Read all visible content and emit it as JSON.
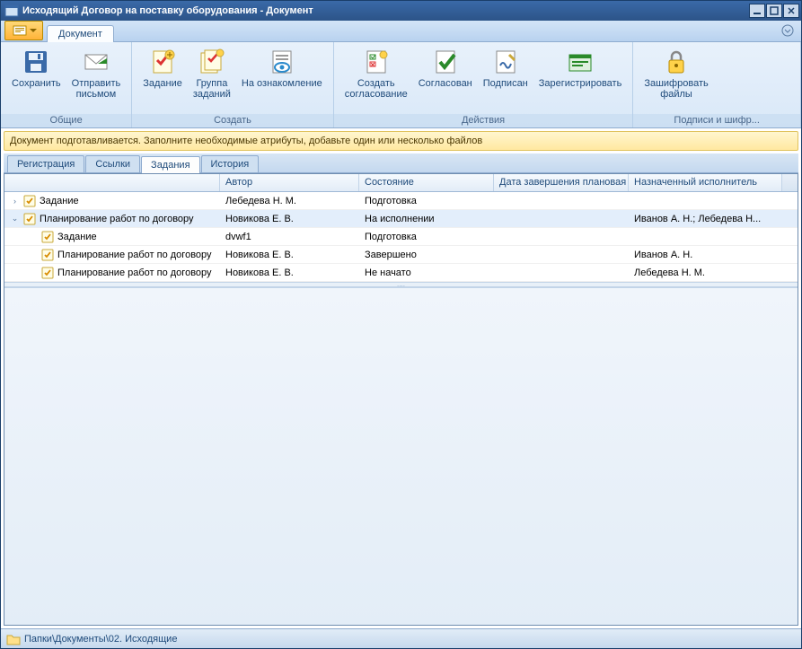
{
  "window": {
    "title": "Исходящий Договор на поставку оборудования - Документ"
  },
  "ribbon": {
    "tab": "Документ",
    "groups": {
      "general": {
        "label": "Общие",
        "save": "Сохранить",
        "send": "Отправить\nписьмом"
      },
      "create": {
        "label": "Создать",
        "task": "Задание",
        "taskgroup": "Группа\nзаданий",
        "review": "На ознакомление"
      },
      "actions": {
        "label": "Действия",
        "approval": "Создать\nсогласование",
        "approved": "Согласован",
        "signed": "Подписан",
        "register": "Зарегистрировать"
      },
      "sign": {
        "label": "Подписи и шифр...",
        "encrypt": "Зашифровать\nфайлы"
      }
    }
  },
  "infobar": "Документ подготавливается. Заполните необходимые атрибуты, добавьте один или несколько файлов",
  "tabs": {
    "reg": "Регистрация",
    "links": "Ссылки",
    "tasks": "Задания",
    "history": "История"
  },
  "grid": {
    "headers": {
      "author": "Автор",
      "state": "Состояние",
      "due": "Дата завершения плановая",
      "assignee": "Назначенный исполнитель"
    },
    "rows": [
      {
        "indent": 0,
        "expander": "›",
        "name": "Задание",
        "author": "Лебедева Н. М.",
        "state": "Подготовка",
        "due": "",
        "assignee": "",
        "selected": false
      },
      {
        "indent": 0,
        "expander": "⌄",
        "name": "Планирование работ по договору",
        "author": "Новикова Е. В.",
        "state": "На исполнении",
        "due": "",
        "assignee": "Иванов А. Н.; Лебедева Н...",
        "selected": true
      },
      {
        "indent": 1,
        "expander": "",
        "name": "Задание",
        "author": "dvwf1",
        "state": "Подготовка",
        "due": "",
        "assignee": "",
        "selected": false
      },
      {
        "indent": 1,
        "expander": "",
        "name": "Планирование работ по договору",
        "author": "Новикова Е. В.",
        "state": "Завершено",
        "due": "",
        "assignee": "Иванов А. Н.",
        "selected": false
      },
      {
        "indent": 1,
        "expander": "",
        "name": "Планирование работ по договору",
        "author": "Новикова Е. В.",
        "state": "Не начато",
        "due": "",
        "assignee": "Лебедева Н. М.",
        "selected": false
      }
    ]
  },
  "statusbar": {
    "path": "Папки\\Документы\\02. Исходящие"
  }
}
